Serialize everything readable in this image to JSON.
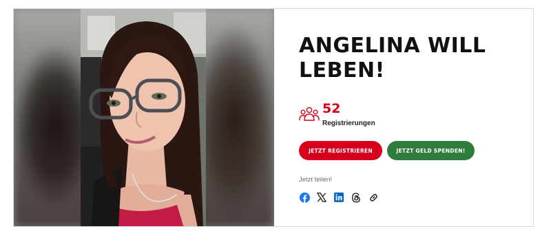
{
  "campaign": {
    "title": "ANGELINA WILL LEBEN!",
    "registrations_count": "52",
    "registrations_label": "Registrierungen"
  },
  "actions": {
    "register_label": "JETZT REGISTRIEREN",
    "donate_label": "JETZT GELD SPENDEN!"
  },
  "share": {
    "label": "Jetzt teilen!",
    "icons": [
      "facebook-icon",
      "x-icon",
      "linkedin-icon",
      "threads-icon",
      "link-icon"
    ]
  },
  "colors": {
    "accent_red": "#d6001c",
    "accent_green": "#2f7d3b",
    "facebook_blue": "#1877f2",
    "linkedin_blue": "#0a66c2"
  }
}
